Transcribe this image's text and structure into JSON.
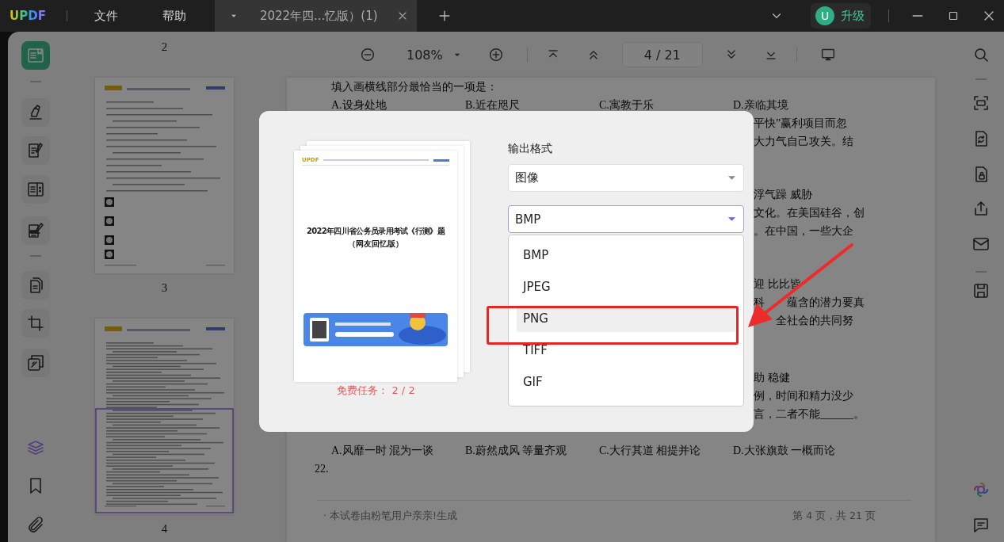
{
  "titlebar": {
    "logo": "UPDF",
    "menus": [
      "文件",
      "帮助"
    ],
    "tabs": [
      {
        "title": "2022年四...忆版）(1)",
        "selected": true
      }
    ],
    "avatar": "U",
    "upgrade": "升级"
  },
  "toolbar": {
    "zoom": "108%",
    "page": "4 / 21"
  },
  "left_tools": [
    {
      "selected": true
    },
    {
      "selected": false
    },
    {
      "selected": false
    },
    {
      "selected": false
    },
    {
      "selected": false
    },
    {
      "selected": false
    },
    {
      "selected": false
    },
    {
      "selected": false
    }
  ],
  "panel_tools": [
    {
      "selected": true
    },
    {
      "selected": false
    },
    {
      "selected": false
    }
  ],
  "thumbnails": {
    "previous_label": "2",
    "pages": [
      {
        "label": "3",
        "selected": false
      },
      {
        "label": "4",
        "selected": true
      }
    ]
  },
  "document": {
    "groups": [
      {
        "lines": [
          {
            "kind": "text",
            "text": "填入画横线部分最恰当的一项是："
          },
          {
            "kind": "options",
            "options": [
              "A.设身处地",
              "B.近在咫尺",
              "C.寓教于乐",
              "D.亲临其境"
            ]
          },
          {
            "kind": "fragment",
            "text": "平快”赢利项目而忽"
          },
          {
            "kind": "fragment",
            "text": "大力气自己攻关。结"
          }
        ]
      },
      {
        "lines": [
          {
            "kind": "fragment",
            "text": "浮气躁 威胁"
          },
          {
            "kind": "fragment",
            "text": "文化。在美国硅谷，创"
          },
          {
            "kind": "fragment",
            "text": "。在中国，一些大企"
          }
        ]
      },
      {
        "lines": [
          {
            "kind": "fragment",
            "text": "迎 比比皆"
          },
          {
            "kind": "covered_fragment",
            "lead": "科",
            "text": "蕴含的潜力要真"
          },
          {
            "kind": "covered_fragment",
            "text": "全社会的共同努"
          }
        ]
      },
      {
        "lines": [
          {
            "kind": "fragment",
            "text": "助 稳健"
          },
          {
            "kind": "fragment",
            "text": "例，时间和精力没少"
          },
          {
            "kind": "fragment",
            "text": "言，二者不能______。"
          }
        ]
      },
      {
        "lines": [
          {
            "kind": "options",
            "options": [
              "A.风靡一时 混为一谈",
              "B.蔚然成风 等量齐观",
              "C.大行其道 相提并论",
              "D.大张旗鼓 一概而论"
            ]
          },
          {
            "kind": "number",
            "text": "22."
          }
        ]
      }
    ],
    "footer": {
      "left": "· 本试卷由粉笔用户亲亲!生成",
      "right": "第 4 页，共 21 页"
    }
  },
  "dialog": {
    "preview": {
      "logo": "UPDF",
      "title": "2022年四川省公务员录用考试《行测》题",
      "subtitle": "（网友回忆版）"
    },
    "quota": "免费任务： 2 / 2",
    "format_label": "输出格式",
    "format_select": {
      "value": "图像"
    },
    "type_select": {
      "value": "BMP",
      "expanded": true
    },
    "type_options": [
      {
        "label": "BMP",
        "highlighted": false
      },
      {
        "label": "JPEG",
        "highlighted": false
      },
      {
        "label": "PNG",
        "highlighted": true
      },
      {
        "label": "TIFF",
        "highlighted": false
      },
      {
        "label": "GIF",
        "highlighted": false
      }
    ]
  }
}
